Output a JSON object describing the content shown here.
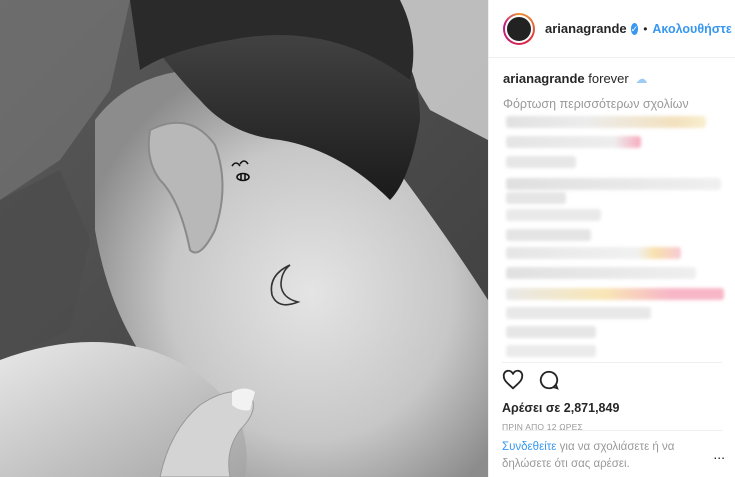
{
  "header": {
    "username": "arianagrande",
    "follow_label": "Ακολουθήστε",
    "separator": "•"
  },
  "caption": {
    "username": "arianagrande",
    "text": "forever"
  },
  "load_more_comments": "Φόρτωση περισσότερων σχολίων",
  "likes_label": "Αρέσει σε 2,871,849",
  "timestamp": "ΠΡΙΝ ΑΠΟ 12 ΩΡΕΣ",
  "login_prompt": {
    "link": "Συνδεθείτε",
    "text": " για να σχολιάσετε ή να δηλώσετε ότι σας αρέσει."
  },
  "more_options": "...",
  "colors": {
    "accent": "#3897f0",
    "muted": "#999999",
    "text": "#262626"
  }
}
